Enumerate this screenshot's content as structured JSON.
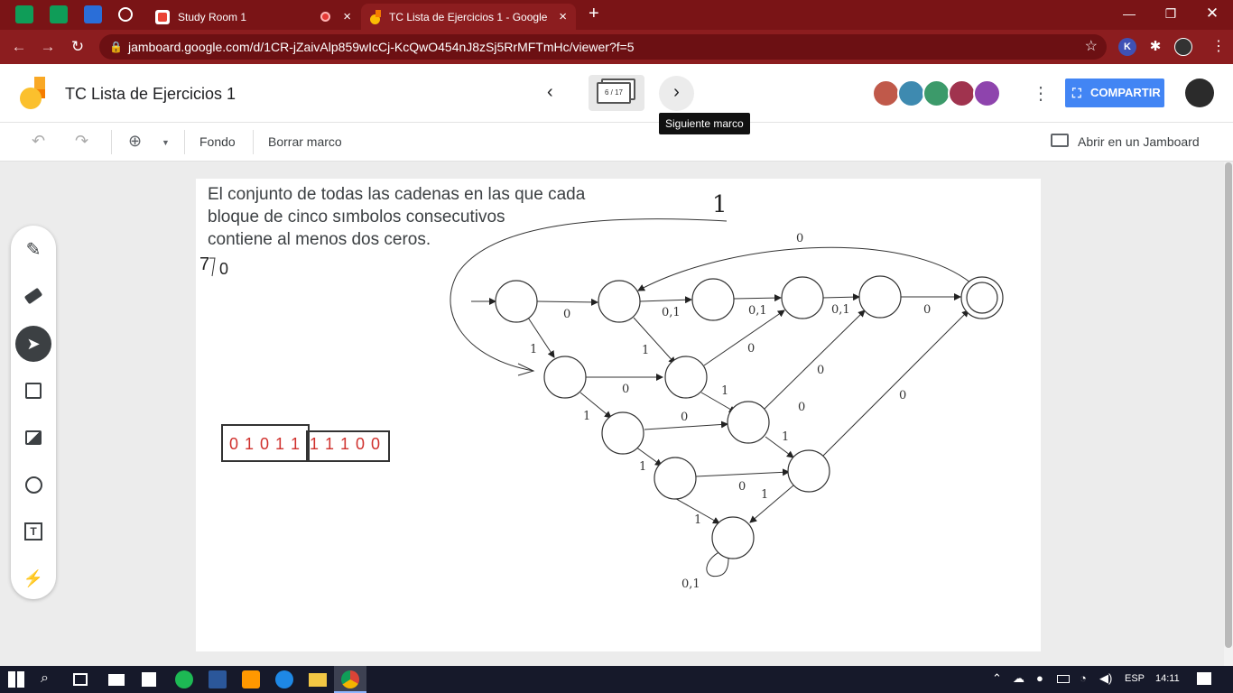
{
  "browser": {
    "tabs": [
      {
        "title": "Study Room 1",
        "icon": "meet-icon"
      },
      {
        "title": "TC Lista de Ejercicios 1 - Google J",
        "icon": "jamboard-icon",
        "active": true
      }
    ],
    "new_tab_glyph": "+",
    "url": "jamboard.google.com/d/1CR-jZaivAlp859wIcCj-KcQwO454nJ8zSj5RrMFTmHc/viewer?f=5"
  },
  "header": {
    "title": "TC Lista de Ejercicios 1",
    "frame_counter": "6 / 17",
    "tooltip": "Siguiente marco",
    "share_label": "COMPARTIR"
  },
  "toolbar": {
    "background_label": "Fondo",
    "clear_frame_label": "Borrar marco",
    "open_in_jamboard_label": "Abrir en un Jamboard"
  },
  "canvas": {
    "text_lines": [
      "El conjunto de todas las cadenas en las que cada",
      "bloque de cinco sımbolos consecutivos",
      "contiene al menos dos ceros."
    ],
    "binary_left": "0 1 0 1 1",
    "binary_right": "1 1 1 0 0",
    "handwritten_top": "1",
    "handwritten_left": "7",
    "handwritten_small": "0",
    "edge_labels": [
      "0",
      "0",
      "0,1",
      "0,1",
      "0,1",
      "0",
      "1",
      "1",
      "0",
      "0",
      "1",
      "0",
      "1",
      "0",
      "1",
      "0",
      "1",
      "1",
      "0",
      "1",
      "0",
      "0,1"
    ]
  },
  "taskbar": {
    "language": "ESP",
    "time": "14:11"
  },
  "colors": {
    "tab_strip": "#7a1416",
    "omnibox_bar": "#8c1d1f",
    "share_blue": "#4285f4",
    "binary_red": "#d0312d",
    "taskbar": "#16192a"
  }
}
